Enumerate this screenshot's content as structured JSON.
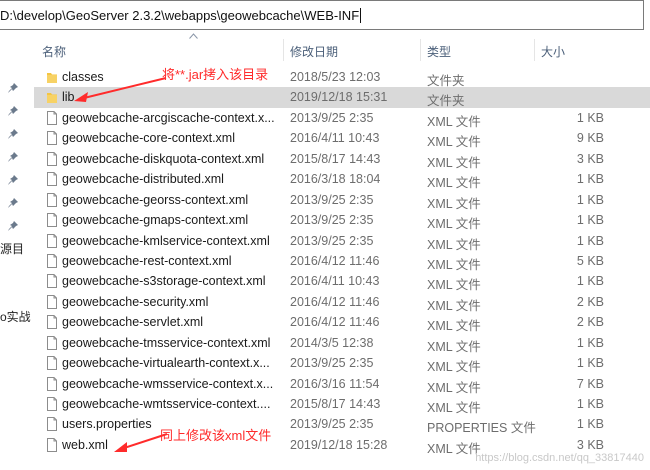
{
  "address": {
    "path": "D:\\develop\\GeoServer 2.3.2\\webapps\\geowebcache\\WEB-INF"
  },
  "nav": {
    "labels": [
      "源目 ",
      "o实战"
    ]
  },
  "columns": {
    "name": "名称",
    "date": "修改日期",
    "type": "类型",
    "size": "大小"
  },
  "files": [
    {
      "name": "classes",
      "date": "2018/5/23 12:03",
      "type": "文件夹",
      "size": "",
      "icon": "folder-icon"
    },
    {
      "name": "lib",
      "date": "2019/12/18 15:31",
      "type": "文件夹",
      "size": "",
      "icon": "folder-icon",
      "selected": true
    },
    {
      "name": "geowebcache-arcgiscache-context.x...",
      "date": "2013/9/25 2:35",
      "type": "XML 文件",
      "size": "1 KB",
      "icon": "file-icon"
    },
    {
      "name": "geowebcache-core-context.xml",
      "date": "2016/4/11 10:43",
      "type": "XML 文件",
      "size": "9 KB",
      "icon": "file-icon"
    },
    {
      "name": "geowebcache-diskquota-context.xml",
      "date": "2015/8/17 14:43",
      "type": "XML 文件",
      "size": "3 KB",
      "icon": "file-icon"
    },
    {
      "name": "geowebcache-distributed.xml",
      "date": "2016/3/18 18:04",
      "type": "XML 文件",
      "size": "1 KB",
      "icon": "file-icon"
    },
    {
      "name": "geowebcache-georss-context.xml",
      "date": "2013/9/25 2:35",
      "type": "XML 文件",
      "size": "1 KB",
      "icon": "file-icon"
    },
    {
      "name": "geowebcache-gmaps-context.xml",
      "date": "2013/9/25 2:35",
      "type": "XML 文件",
      "size": "1 KB",
      "icon": "file-icon"
    },
    {
      "name": "geowebcache-kmlservice-context.xml",
      "date": "2013/9/25 2:35",
      "type": "XML 文件",
      "size": "1 KB",
      "icon": "file-icon"
    },
    {
      "name": "geowebcache-rest-context.xml",
      "date": "2016/4/12 11:46",
      "type": "XML 文件",
      "size": "5 KB",
      "icon": "file-icon"
    },
    {
      "name": "geowebcache-s3storage-context.xml",
      "date": "2016/4/11 10:43",
      "type": "XML 文件",
      "size": "1 KB",
      "icon": "file-icon"
    },
    {
      "name": "geowebcache-security.xml",
      "date": "2016/4/12 11:46",
      "type": "XML 文件",
      "size": "2 KB",
      "icon": "file-icon"
    },
    {
      "name": "geowebcache-servlet.xml",
      "date": "2016/4/12 11:46",
      "type": "XML 文件",
      "size": "2 KB",
      "icon": "file-icon"
    },
    {
      "name": "geowebcache-tmsservice-context.xml",
      "date": "2014/3/5 12:38",
      "type": "XML 文件",
      "size": "1 KB",
      "icon": "file-icon"
    },
    {
      "name": "geowebcache-virtualearth-context.x...",
      "date": "2013/9/25 2:35",
      "type": "XML 文件",
      "size": "1 KB",
      "icon": "file-icon"
    },
    {
      "name": "geowebcache-wmsservice-context.x...",
      "date": "2016/3/16 11:54",
      "type": "XML 文件",
      "size": "7 KB",
      "icon": "file-icon"
    },
    {
      "name": "geowebcache-wmtsservice-context....",
      "date": "2015/8/17 14:43",
      "type": "XML 文件",
      "size": "1 KB",
      "icon": "file-icon"
    },
    {
      "name": "users.properties",
      "date": "2013/9/25 2:35",
      "type": "PROPERTIES 文件",
      "size": "1 KB",
      "icon": "file-icon"
    },
    {
      "name": "web.xml",
      "date": "2019/12/18 15:28",
      "type": "XML 文件",
      "size": "3 KB",
      "icon": "file-icon"
    }
  ],
  "annotations": {
    "jar_note": "将**.jar拷入该目录",
    "xml_note": "同上修改该xml文件",
    "color": "#ff2b2b"
  },
  "watermark": "https://blog.csdn.net/qq_33817440",
  "colors": {
    "selection": "#d9d9d9",
    "folder": "#f4c542",
    "header_text": "#4c607a"
  }
}
